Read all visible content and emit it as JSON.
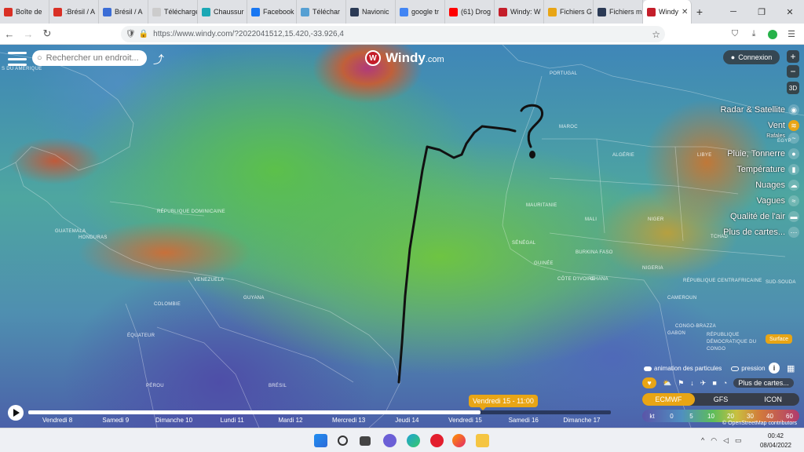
{
  "browser": {
    "tabs": [
      {
        "label": "Boîte de",
        "icon": "gmail-icon",
        "color": "#d93025"
      },
      {
        "label": ":Brésil / A",
        "icon": "gmail-icon",
        "color": "#d93025"
      },
      {
        "label": "Brésil / A",
        "icon": "globe-icon",
        "color": "#3b6dd6"
      },
      {
        "label": "Télécharger D",
        "icon": "blank-icon",
        "color": "#cccccc"
      },
      {
        "label": "Chaussur",
        "icon": "v-icon",
        "color": "#1ba8b5"
      },
      {
        "label": "Facebook",
        "icon": "facebook-icon",
        "color": "#1877f2"
      },
      {
        "label": "Téléchar",
        "icon": "cloud-icon",
        "color": "#56a0d3"
      },
      {
        "label": "Navionic",
        "icon": "navionics-icon",
        "color": "#2b3a55"
      },
      {
        "label": "google tr",
        "icon": "google-icon",
        "color": "#4285f4"
      },
      {
        "label": "(61) Drog",
        "icon": "youtube-icon",
        "color": "#ff0000"
      },
      {
        "label": "Windy: W",
        "icon": "windy-icon",
        "color": "#c41e2a"
      },
      {
        "label": "Fichiers G",
        "icon": "files-icon",
        "color": "#e8a515"
      },
      {
        "label": "Fichiers m",
        "icon": "navionics-icon",
        "color": "#2b3a55"
      },
      {
        "label": "Windy",
        "icon": "windy-icon",
        "color": "#c41e2a",
        "active": true
      }
    ],
    "url": "https://www.windy.com/?2022041512,15.420,-33.926,4",
    "new_tab": "+",
    "win_min": "─",
    "win_max": "❐",
    "win_close": "✕"
  },
  "map": {
    "search_placeholder": "Rechercher un endroit...",
    "logo_text": "Windy",
    "logo_suffix": ".com",
    "login_label": "Connexion",
    "zoom_in": "+",
    "zoom_out": "−",
    "view_3d": "3D",
    "labels": {
      "amerique": "S DU AMÉRIQUE",
      "maroc": "MAROC",
      "algerie": "ALGÉRIE",
      "libye": "LIBYE",
      "egypt": "ÉGYP",
      "mauritanie": "MAURITANIE",
      "mali": "MALI",
      "niger": "NIGER",
      "tchad": "TCHAD",
      "venezuela": "VENEZUELA",
      "colombie": "COLOMBIE",
      "equateur": "ÉQUATEUR",
      "perou": "PÉROU",
      "bresil": "BRÉSIL",
      "guyana": "GUYANA",
      "senegal": "SÉNÉGAL",
      "guinee": "GUINÉE",
      "cote_ivoire": "CÔTE D'IVOIRE",
      "ghana": "GHANA",
      "nigeria": "NIGERIA",
      "burkina": "BURKINA FASO",
      "cameroun": "CAMEROUN",
      "gabon": "GABON",
      "congo_brazza": "CONGO-BRAZZA",
      "rca": "RÉPUBLIQUE CENTRAFRICAINE",
      "rdc": "RÉPUBLIQUE DÉMOCRATIQUE DU CONGO",
      "soudan_sud": "SUD-SOUDA",
      "guatemala": "GUATEMALA",
      "honduras": "HONDURAS",
      "rep_dom": "RÉPUBLIQUE DOMINICAINE",
      "portugal": "PORTUGAL"
    },
    "annotation_mark": "?"
  },
  "layers_menu": {
    "items": [
      {
        "label": "Radar & Satellite",
        "icon": "radar-icon"
      },
      {
        "label": "Vent",
        "icon": "wind-icon",
        "active": true
      },
      {
        "label": "Rafales",
        "icon": "gust-icon",
        "small": true
      },
      {
        "label": "Pluie, Tonnerre",
        "icon": "rain-icon"
      },
      {
        "label": "Température",
        "icon": "thermometer-icon"
      },
      {
        "label": "Nuages",
        "icon": "cloud-icon"
      },
      {
        "label": "Vagues",
        "icon": "waves-icon"
      },
      {
        "label": "Qualité de l'air",
        "icon": "car-icon"
      },
      {
        "label": "Plus de cartes...",
        "icon": "more-icon"
      }
    ],
    "surface_label": "Surface"
  },
  "bottom_panel": {
    "particles_label": "animation des particules",
    "pressure_label": "pression",
    "info": "i",
    "more_layers": "Plus de cartes...",
    "models": [
      {
        "label": "ECMWF",
        "selected": true
      },
      {
        "label": "GFS"
      },
      {
        "label": "ICON"
      }
    ],
    "scale_unit": "kt",
    "scale_values": [
      "0",
      "5",
      "10",
      "20",
      "30",
      "40",
      "60"
    ],
    "attribution": "© OpenStreetMap contributors"
  },
  "timeline": {
    "current": "Vendredi 15 - 11:00",
    "progress": 0.776,
    "days": [
      "Vendredi 8",
      "Samedi 9",
      "Dimanche 10",
      "Lundi 11",
      "Mardi 12",
      "Mercredi 13",
      "Jeudi 14",
      "Vendredi 15",
      "Samedi 16",
      "Dimanche 17"
    ]
  },
  "taskbar": {
    "time": "00:42",
    "date": "08/04/2022",
    "caret": "^"
  }
}
